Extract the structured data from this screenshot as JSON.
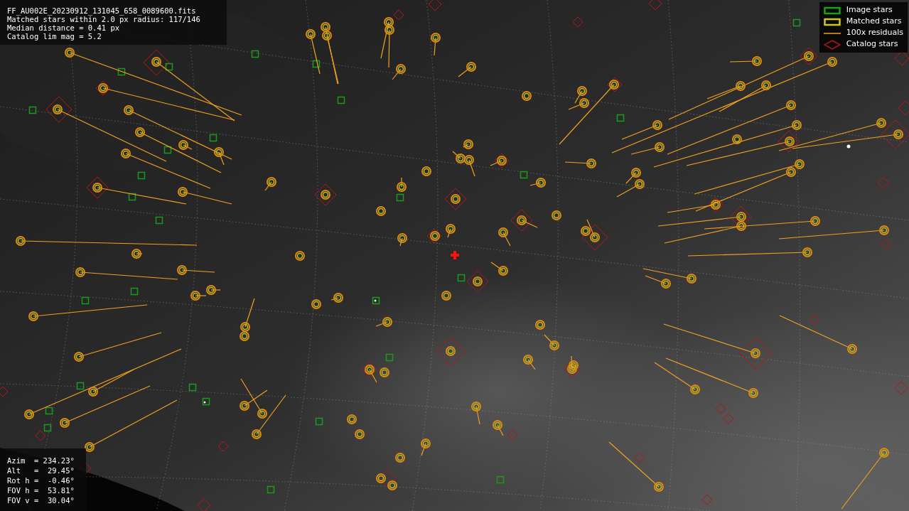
{
  "file_info": {
    "lines": [
      "FF_AU002E_20230912_131045_658_0089600.fits",
      "Matched stars within 2.0 px radius: 117/146",
      "Median distance = 0.41 px",
      "Catalog lim mag = 5.2"
    ]
  },
  "legend": [
    {
      "label": "Image stars"
    },
    {
      "kind": "matched",
      "label": "Matched stars"
    },
    {
      "kind": "residual",
      "label": "100x residuals"
    },
    {
      "kind": "catalog",
      "label": "Catalog stars"
    }
  ],
  "pointing": [
    "Azim  = 234.23°",
    "Alt   =  29.45°",
    "Rot h =  -0.46°",
    "FOV h =  53.81°",
    "FOV v =  30.04°"
  ]
}
